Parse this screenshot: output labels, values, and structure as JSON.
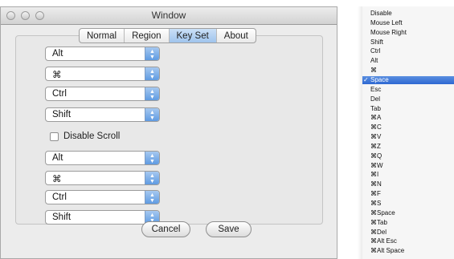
{
  "window": {
    "title": "Window",
    "tabs": [
      {
        "label": "Normal",
        "selected": false
      },
      {
        "label": "Region",
        "selected": false
      },
      {
        "label": "Key Set",
        "selected": true
      },
      {
        "label": "About",
        "selected": false
      }
    ],
    "popups_top": [
      "Alt",
      "⌘",
      "Ctrl",
      "Shift"
    ],
    "checkbox": {
      "label": "Disable Scroll",
      "checked": false
    },
    "popups_bottom": [
      "Alt",
      "⌘",
      "Ctrl",
      "Shift"
    ],
    "buttons": {
      "cancel": "Cancel",
      "save": "Save"
    }
  },
  "menu": {
    "items": [
      {
        "label": "Disable",
        "selected": false
      },
      {
        "label": "Mouse Left",
        "selected": false
      },
      {
        "label": "Mouse Right",
        "selected": false
      },
      {
        "label": "Shift",
        "selected": false
      },
      {
        "label": "Ctrl",
        "selected": false
      },
      {
        "label": "Alt",
        "selected": false
      },
      {
        "label": "⌘",
        "selected": false
      },
      {
        "label": "Space",
        "selected": true
      },
      {
        "label": "Esc",
        "selected": false
      },
      {
        "label": "Del",
        "selected": false
      },
      {
        "label": "Tab",
        "selected": false
      },
      {
        "label": "⌘A",
        "selected": false
      },
      {
        "label": "⌘C",
        "selected": false
      },
      {
        "label": "⌘V",
        "selected": false
      },
      {
        "label": "⌘Z",
        "selected": false
      },
      {
        "label": "⌘Q",
        "selected": false
      },
      {
        "label": "⌘W",
        "selected": false
      },
      {
        "label": "⌘I",
        "selected": false
      },
      {
        "label": "⌘N",
        "selected": false
      },
      {
        "label": "⌘F",
        "selected": false
      },
      {
        "label": "⌘S",
        "selected": false
      },
      {
        "label": "⌘Space",
        "selected": false
      },
      {
        "label": "⌘Tab",
        "selected": false
      },
      {
        "label": "⌘Del",
        "selected": false
      },
      {
        "label": "⌘Alt Esc",
        "selected": false
      },
      {
        "label": "⌘Alt Space",
        "selected": false
      }
    ],
    "selected_mark": "✓"
  },
  "colors": {
    "selection": "#2e68d2",
    "tab_selected": "#9fc4ed",
    "window_bg": "#ececec"
  }
}
